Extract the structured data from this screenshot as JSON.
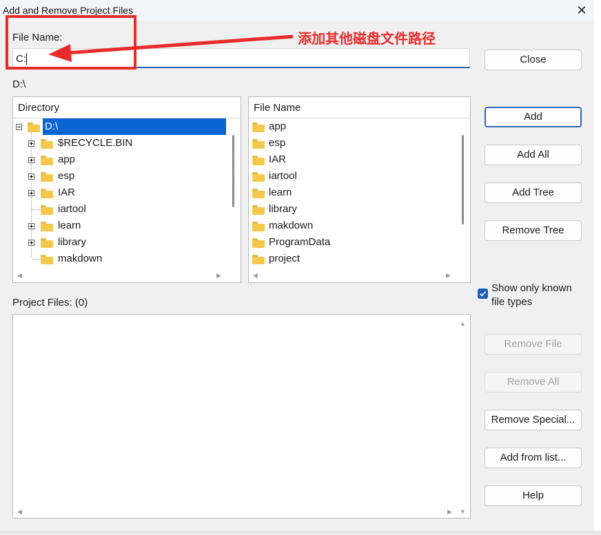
{
  "window": {
    "title": "Add and Remove Project Files",
    "close_glyph": "✕"
  },
  "file_name": {
    "label": "File Name:",
    "value": "C:"
  },
  "current_path": "D:\\",
  "annotation": {
    "text": "添加其他磁盘文件路径",
    "color": "#ea2b2b"
  },
  "directory_panel": {
    "header": "Directory",
    "root": "D:\\",
    "items": [
      {
        "label": "$RECYCLE.BIN",
        "expandable": true
      },
      {
        "label": "app",
        "expandable": true
      },
      {
        "label": "esp",
        "expandable": true
      },
      {
        "label": "IAR",
        "expandable": true
      },
      {
        "label": "iartool",
        "expandable": false
      },
      {
        "label": "learn",
        "expandable": true
      },
      {
        "label": "library",
        "expandable": true
      },
      {
        "label": "makdown",
        "expandable": false
      }
    ]
  },
  "file_panel": {
    "header": "File Name",
    "items": [
      "app",
      "esp",
      "IAR",
      "iartool",
      "learn",
      "library",
      "makdown",
      "ProgramData",
      "project"
    ]
  },
  "project_files": {
    "label": "Project Files: (0)"
  },
  "buttons": {
    "close": "Close",
    "add": "Add",
    "add_all": "Add All",
    "add_tree": "Add Tree",
    "remove_tree": "Remove Tree",
    "remove_file": "Remove File",
    "remove_all": "Remove All",
    "remove_special": "Remove Special...",
    "add_from_list": "Add from list...",
    "help": "Help"
  },
  "options": {
    "show_known_label": "Show only known file types",
    "show_known_checked": true
  },
  "colors": {
    "accent": "#1f63b3",
    "selection": "#0a64d2",
    "folder": "#f5c84c"
  }
}
